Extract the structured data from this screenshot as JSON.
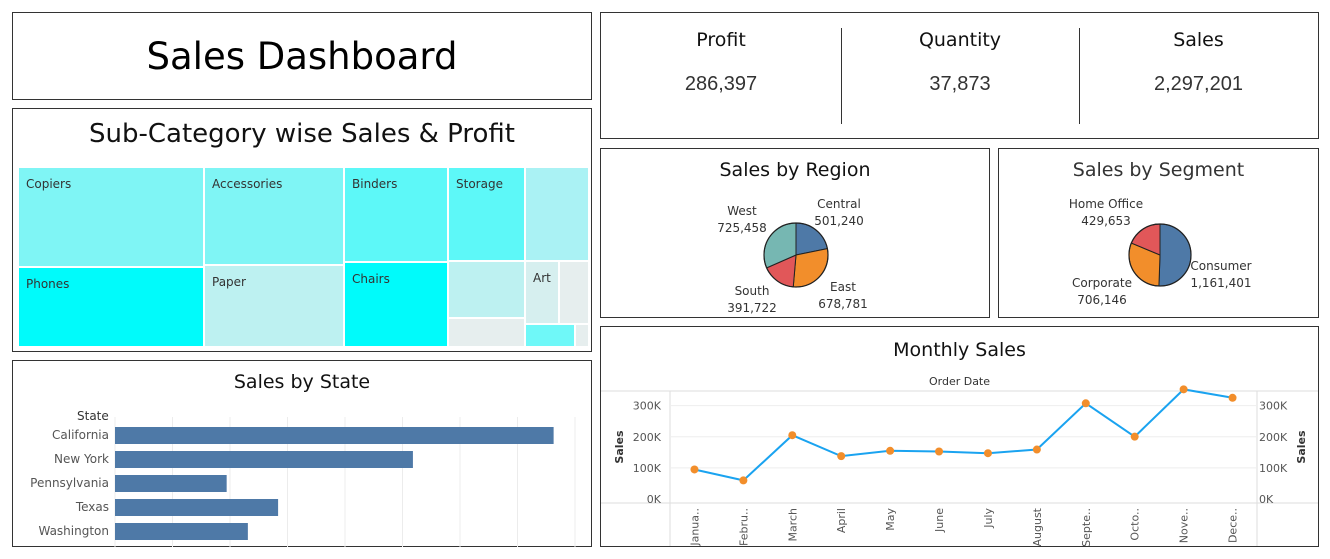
{
  "dashboard": {
    "title": "Sales Dashboard"
  },
  "kpis": [
    {
      "label": "Profit",
      "value": "286,397"
    },
    {
      "label": "Quantity",
      "value": "37,873"
    },
    {
      "label": "Sales",
      "value": "2,297,201"
    }
  ],
  "treemap": {
    "title": "Sub-Category wise Sales & Profit",
    "cells": [
      {
        "label": "Copiers",
        "color": "#7ff5f5"
      },
      {
        "label": "Accessories",
        "color": "#7ff5f5"
      },
      {
        "label": "Binders",
        "color": "#5df8f8"
      },
      {
        "label": "Storage",
        "color": "#5df8f8"
      },
      {
        "label": "",
        "color": "#aaf2f4"
      },
      {
        "label": "Phones",
        "color": "#00fbfb"
      },
      {
        "label": "Paper",
        "color": "#bdf1f1"
      },
      {
        "label": "Chairs",
        "color": "#00fbfb"
      },
      {
        "label": "",
        "color": "#bdf1f1"
      },
      {
        "label": "",
        "color": "#e6eeee"
      },
      {
        "label": "Art",
        "color": "#d6efef"
      },
      {
        "label": "",
        "color": "#e6eeee"
      },
      {
        "label": "",
        "color": "#6ff8f8"
      },
      {
        "label": "",
        "color": "#e6eeee"
      }
    ]
  },
  "state_chart": {
    "title": "Sales by State",
    "axis_header": "State"
  },
  "region_chart": {
    "title": "Sales by Region"
  },
  "segment_chart": {
    "title": "Sales by Segment"
  },
  "monthly_chart": {
    "title": "Monthly Sales",
    "x_header": "Order Date",
    "y_label_left": "Sales",
    "y_label_right": "Sales",
    "y_ticks": [
      "0K",
      "100K",
      "200K",
      "300K"
    ]
  },
  "colors": {
    "bar": "#4e79a7",
    "line": "#1aa3f0",
    "point": "#f28e2b",
    "pie_blue": "#4e79a7",
    "pie_orange": "#f28e2b",
    "pie_red": "#e15759",
    "pie_teal": "#76b7b2"
  },
  "chart_data": [
    {
      "type": "bar",
      "title": "Sales by State",
      "categories": [
        "California",
        "New York",
        "Pennsylvania",
        "Texas",
        "Washington"
      ],
      "values": [
        457688,
        310876,
        116512,
        170188,
        138641
      ],
      "xlim": [
        0,
        480000
      ],
      "grid": true
    },
    {
      "type": "pie",
      "title": "Sales by Region",
      "categories": [
        "Central",
        "East",
        "South",
        "West"
      ],
      "values": [
        501240,
        678781,
        391722,
        725458
      ],
      "value_labels": [
        "501,240",
        "678,781",
        "391,722",
        "725,458"
      ],
      "colors": [
        "#4e79a7",
        "#f28e2b",
        "#e15759",
        "#76b7b2"
      ]
    },
    {
      "type": "pie",
      "title": "Sales by Segment",
      "categories": [
        "Consumer",
        "Corporate",
        "Home Office"
      ],
      "values": [
        1161401,
        706146,
        429653
      ],
      "value_labels": [
        "1,161,401",
        "706,146",
        "429,653"
      ],
      "colors": [
        "#4e79a7",
        "#f28e2b",
        "#e15759"
      ]
    },
    {
      "type": "line",
      "title": "Monthly Sales",
      "xlabel": "Order Date",
      "ylabel": "Sales",
      "categories": [
        "Janua..",
        "Febru..",
        "March",
        "April",
        "May",
        "June",
        "July",
        "August",
        "Septe..",
        "Octo..",
        "Nove..",
        "Dece.."
      ],
      "values": [
        94925,
        59751,
        205005,
        137762,
        155029,
        152718,
        147238,
        159044,
        307650,
        200323,
        352461,
        325294
      ],
      "ylim": [
        0,
        360000
      ],
      "grid": true
    },
    {
      "type": "heatmap",
      "title": "Sub-Category wise Sales & Profit",
      "categories": [
        "Copiers",
        "Accessories",
        "Binders",
        "Storage",
        "Phones",
        "Paper",
        "Chairs",
        "Art"
      ]
    }
  ]
}
